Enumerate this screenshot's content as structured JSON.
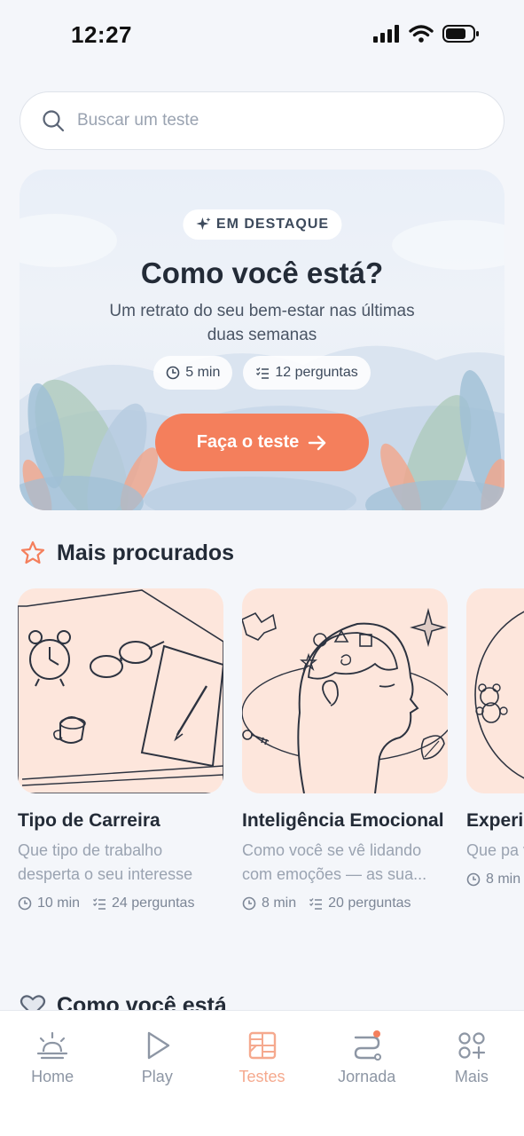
{
  "status": {
    "time": "12:27"
  },
  "search": {
    "placeholder": "Buscar um teste"
  },
  "featured": {
    "badge": "EM DESTAQUE",
    "title": "Como você está?",
    "subtitle": "Um retrato do seu bem-estar nas últimas duas semanas",
    "duration": "5 min",
    "questions": "12 perguntas",
    "cta": "Faça o teste"
  },
  "popular": {
    "title": "Mais procurados",
    "cards": [
      {
        "title": "Tipo de Carreira",
        "desc": "Que tipo de trabalho desperta o seu interesse",
        "duration": "10 min",
        "questions": "24 perguntas"
      },
      {
        "title": "Inteligência Emocional",
        "desc": "Como você se vê lidando com emoções — as sua...",
        "duration": "8 min",
        "questions": "20 perguntas"
      },
      {
        "title": "Experi Infânc",
        "desc": "Que pa você tro",
        "duration": "8 min",
        "questions": ""
      }
    ]
  },
  "section2": {
    "title": "Como você está"
  },
  "nav": {
    "items": [
      {
        "label": "Home",
        "icon": "sunrise-icon"
      },
      {
        "label": "Play",
        "icon": "play-icon"
      },
      {
        "label": "Testes",
        "icon": "tests-icon"
      },
      {
        "label": "Jornada",
        "icon": "journey-icon"
      },
      {
        "label": "Mais",
        "icon": "more-icon"
      }
    ],
    "active": "Testes"
  },
  "colors": {
    "accent": "#f47f5c",
    "card_bg": "#fde6dc",
    "active_nav": "#f5a98e"
  }
}
